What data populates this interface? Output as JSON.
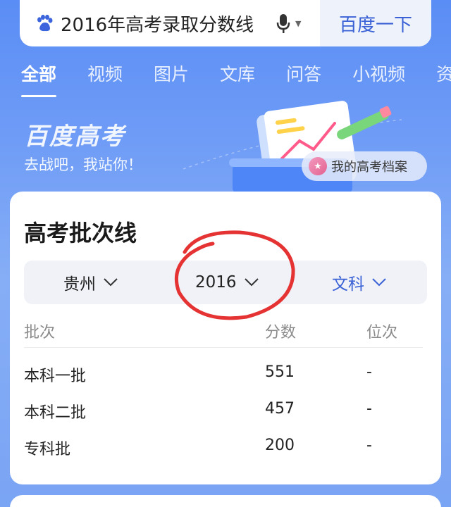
{
  "search": {
    "query": "2016年高考录取分数线",
    "button_label": "百度一下"
  },
  "tabs": [
    {
      "label": "全部",
      "active": true
    },
    {
      "label": "视频",
      "active": false
    },
    {
      "label": "图片",
      "active": false
    },
    {
      "label": "文库",
      "active": false
    },
    {
      "label": "问答",
      "active": false
    },
    {
      "label": "小视频",
      "active": false
    },
    {
      "label": "资",
      "active": false
    }
  ],
  "banner": {
    "brand": "百度高考",
    "slogan": "去战吧，我站你！",
    "archive_label": "我的高考档案"
  },
  "card": {
    "title": "高考批次线",
    "selectors": {
      "province": "贵州",
      "year": "2016",
      "category": "文科"
    },
    "columns": [
      "批次",
      "分数",
      "位次"
    ],
    "rows": [
      {
        "batch": "本科一批",
        "score": "551",
        "rank": "-"
      },
      {
        "batch": "本科二批",
        "score": "457",
        "rank": "-"
      },
      {
        "batch": "专科批",
        "score": "200",
        "rank": "-"
      }
    ]
  },
  "colors": {
    "accent": "#3a62d6",
    "annotation": "#e53232",
    "background": "#6f9cf6"
  }
}
